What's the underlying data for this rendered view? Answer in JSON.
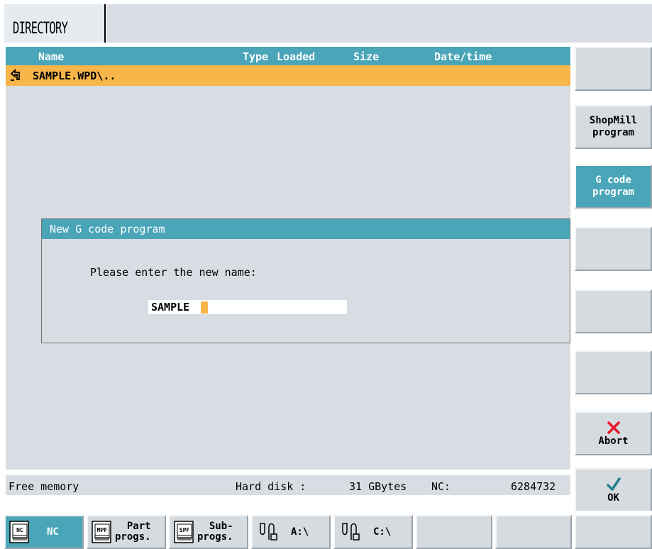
{
  "header": {
    "title": "DIRECTORY"
  },
  "list": {
    "columns": {
      "name": "Name",
      "type": "Type",
      "loaded": "Loaded",
      "size": "Size",
      "datetime": "Date/time"
    },
    "rows": [
      {
        "name": "SAMPLE.WPD\\.."
      }
    ]
  },
  "dialog": {
    "title": "New G code program",
    "prompt": "Please enter the new name:",
    "value": "SAMPLE"
  },
  "status": {
    "free_memory": "Free memory",
    "hard_disk_label": "Hard disk :",
    "hard_disk_value": "31 GBytes",
    "nc_label": "NC:",
    "nc_value": "6284732"
  },
  "softkeys": {
    "shopmill_1": "ShopMill",
    "shopmill_2": "program",
    "gcode_1": "G code",
    "gcode_2": "program",
    "abort": "Abort",
    "ok": "OK"
  },
  "bottom": {
    "nc": "NC",
    "nc_icon": "NC",
    "part_1": "Part",
    "part_2": "progs.",
    "mpf_icon": "MPF",
    "sub_1": "Sub-",
    "sub_2": "progs.",
    "spf_icon": "SPF",
    "drive_a": "A:\\",
    "drive_c": "C:\\"
  },
  "colors": {
    "teal": "#4aa5b8",
    "orange": "#f7b54a",
    "panel": "#d8dde3",
    "abort_red": "#e8192c",
    "ok_teal": "#1e7f8e"
  }
}
